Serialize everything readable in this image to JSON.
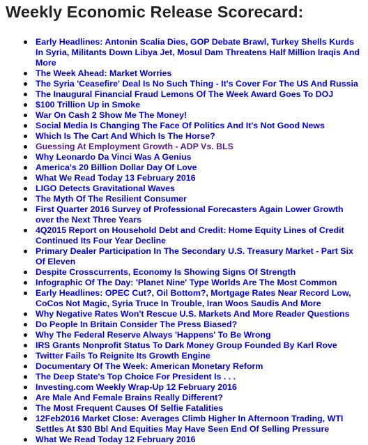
{
  "title": "Weekly Economic Release Scorecard:",
  "colors": {
    "link": "#0000ee",
    "visited_link": "#551a8b",
    "title": "#222222"
  },
  "items": [
    {
      "text": "Early Headlines: Antonin Scalia Dies, GOP Debate Brawl, Turkey Shells Kurds In Syria, Militants Down Libya Jet, Mosul Dam Threatens Half Million Iraqis And More",
      "visited": false
    },
    {
      "text": "The Week Ahead: Market Worries",
      "visited": false
    },
    {
      "text": "The Syria 'Ceasefire' Deal Is No Such Thing - It's Cover For The US And Russia",
      "visited": false
    },
    {
      "text": "The Inaugural Financial Fraud Lemons Of The Week Award Goes To DOJ",
      "visited": false
    },
    {
      "text": "$100 Trillion Up in Smoke",
      "visited": false
    },
    {
      "text": "War On Cash 2 Show Me The Money!",
      "visited": false
    },
    {
      "text": "Social Media Is Changing The Face Of Politics And It's Not Good News",
      "visited": false
    },
    {
      "text": "Which Is The Cart And Which Is The Horse?",
      "visited": false
    },
    {
      "text": "Guessing At Employment Growth - ADP Vs. BLS",
      "visited": true
    },
    {
      "text": "Why Leonardo Da Vinci Was A Genius",
      "visited": false
    },
    {
      "text": "America's 20 Billion Dollar Day Of Love",
      "visited": false
    },
    {
      "text": "What We Read Today 13 February 2016",
      "visited": false
    },
    {
      "text": "LIGO Detects Gravitational Waves",
      "visited": false
    },
    {
      "text": "The Myth Of The Resilient Consumer",
      "visited": false
    },
    {
      "text": "First Quarter 2016 Survey of Professional Forecasters Again Lower Growth over the Next Three Years",
      "visited": false
    },
    {
      "text": "4Q2015 Report on Household Debt and Credit: Home Equity Lines of Credit Continued Its Four Year Decline",
      "visited": false
    },
    {
      "text": "Primary Dealer Participation In The Secondary U.S. Treasury Market - Part Six Of Eleven",
      "visited": false
    },
    {
      "text": "Despite Crosscurrents, Economy Is Showing Signs Of Strength",
      "visited": false
    },
    {
      "text": "Infographic Of The Day: 'Planet Nine' Type Worlds Are The Most Common",
      "visited": false
    },
    {
      "text": "Early Headlines: OPEC Cut?, Oil Bottom?, Mortgage Rates Near Record Low, CoCos Not Magic, Syria Truce In Trouble, Iran Woos Saudis And More",
      "visited": false
    },
    {
      "text": "Why Negative Rates Won't Rescue U.S. Markets And More Reader Questions",
      "visited": false
    },
    {
      "text": "Do People In Britain Consider The Press Biased?",
      "visited": false
    },
    {
      "text": "Why The Federal Reserve Always 'Happens' To Be Wrong",
      "visited": false
    },
    {
      "text": "IRS Grants Nonprofit Status To Dark Money Group Founded By Karl Rove",
      "visited": false
    },
    {
      "text": "Twitter Fails To Reignite Its Growth Engine",
      "visited": false
    },
    {
      "text": "Documentary Of The Week: American Monetary Reform",
      "visited": false
    },
    {
      "text": "The Deep State's Top Choice For President Is . . .",
      "visited": false
    },
    {
      "text": "Investing.com Weekly Wrap-Up 12 February 2016",
      "visited": false
    },
    {
      "text": "Are Male And Female Brains Really Different?",
      "visited": false
    },
    {
      "text": "The Most Frequent Causes Of Selfie Fatalities",
      "visited": false
    },
    {
      "text": "12Feb2016 Market Close: Averages Climb Higher In Afternoon Trading, WTI Settles At $30 Bbl And Equities May Have Seen End Of Selling Pressure",
      "visited": false
    },
    {
      "text": "What We Read Today 12 February 2016",
      "visited": false
    }
  ]
}
